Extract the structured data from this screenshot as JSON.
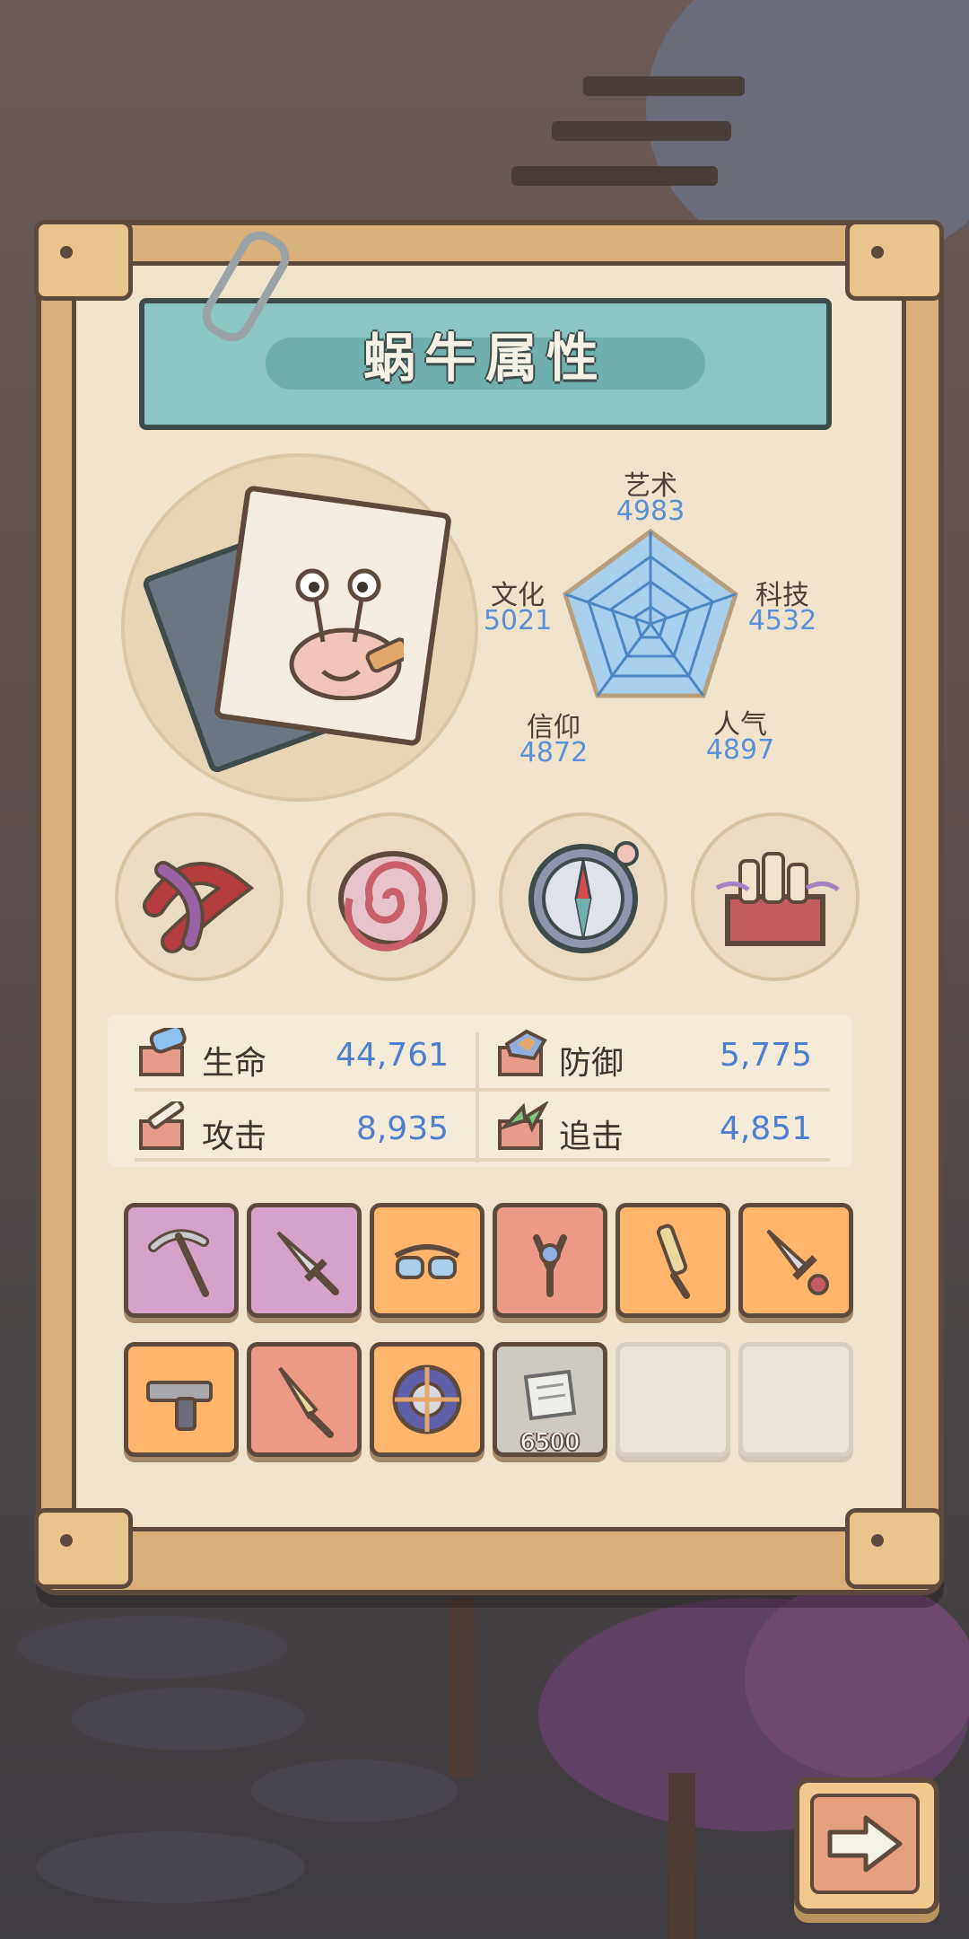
{
  "title": "蜗牛属性",
  "radar": {
    "stats": [
      {
        "label": "艺术",
        "value": "4983"
      },
      {
        "label": "科技",
        "value": "4532"
      },
      {
        "label": "人气",
        "value": "4897"
      },
      {
        "label": "信仰",
        "value": "4872"
      },
      {
        "label": "文化",
        "value": "5021"
      }
    ]
  },
  "items": [
    {
      "icon": "tentacle-relic-icon"
    },
    {
      "icon": "shell-icon"
    },
    {
      "icon": "compass-icon"
    },
    {
      "icon": "potion-box-icon"
    }
  ],
  "combat": {
    "hp_label": "生命",
    "hp_value": "44,761",
    "def_label": "防御",
    "def_value": "5,775",
    "atk_label": "攻击",
    "atk_value": "8,935",
    "pursue_label": "追击",
    "pursue_value": "4,851"
  },
  "equipment": [
    {
      "icon": "pickaxe-icon",
      "rarity": "purple"
    },
    {
      "icon": "dagger-icon",
      "rarity": "purple"
    },
    {
      "icon": "goggles-icon",
      "rarity": "orange"
    },
    {
      "icon": "slingshot-icon",
      "rarity": "red"
    },
    {
      "icon": "sword-icon",
      "rarity": "orange"
    },
    {
      "icon": "ornate-dagger-icon",
      "rarity": "orange"
    },
    {
      "icon": "pistol-icon",
      "rarity": "orange"
    },
    {
      "icon": "knife-icon",
      "rarity": "red"
    },
    {
      "icon": "shield-icon",
      "rarity": "orange"
    },
    {
      "icon": "scroll-icon",
      "rarity": "gray",
      "count": "6500"
    },
    {
      "icon": "empty-slot",
      "rarity": "empty"
    },
    {
      "icon": "empty-slot",
      "rarity": "empty"
    }
  ],
  "next_button_icon": "arrow-right-icon",
  "colors": {
    "accent_blue": "#5b8fd6",
    "title_teal": "#8cc6c2",
    "panel_border": "#5e4a3d"
  }
}
